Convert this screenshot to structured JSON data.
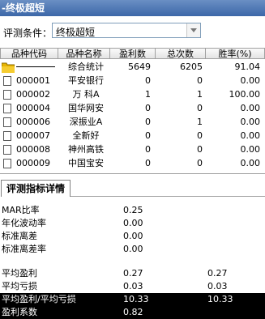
{
  "window": {
    "title": "-终极超短"
  },
  "filter": {
    "label": "评测条件：",
    "selected": "终极超短"
  },
  "table": {
    "headers": [
      "品种代码",
      "品种名称",
      "盈利数",
      "总次数",
      "胜率(%)"
    ],
    "summary": {
      "name": "综合统计",
      "profit": "5649",
      "total": "6205",
      "rate": "91.04"
    },
    "rows": [
      {
        "code": "000001",
        "name": "平安银行",
        "profit": "0",
        "total": "0",
        "rate": "0.00"
      },
      {
        "code": "000002",
        "name": "万 科A",
        "profit": "1",
        "total": "1",
        "rate": "100.00"
      },
      {
        "code": "000004",
        "name": "国华网安",
        "profit": "0",
        "total": "0",
        "rate": "0.00"
      },
      {
        "code": "000006",
        "name": "深振业A",
        "profit": "0",
        "total": "1",
        "rate": "0.00"
      },
      {
        "code": "000007",
        "name": "全新好",
        "profit": "0",
        "total": "0",
        "rate": "0.00"
      },
      {
        "code": "000008",
        "name": "神州高铁",
        "profit": "0",
        "total": "0",
        "rate": "0.00"
      },
      {
        "code": "000009",
        "name": "中国宝安",
        "profit": "0",
        "total": "0",
        "rate": "0.00"
      }
    ]
  },
  "details": {
    "tab_label": "评测指标详情",
    "group1": [
      {
        "label": "MAR比率",
        "value": "0.25"
      },
      {
        "label": "年化波动率",
        "value": "0.00"
      },
      {
        "label": "标准离差",
        "value": "0.00"
      },
      {
        "label": "标准离差率",
        "value": "0.00"
      }
    ],
    "group2": [
      {
        "label": "平均盈利",
        "value": "0.27",
        "value2": "0.27"
      },
      {
        "label": "平均亏损",
        "value": "0.03",
        "value2": "0.03"
      },
      {
        "label": "平均盈利/平均亏损",
        "value": "10.33",
        "value2": "10.33"
      },
      {
        "label": "盈利系数",
        "value": "0.82"
      }
    ]
  },
  "colors": {
    "titlebar": "#3c67a8",
    "highlight": "#000000",
    "folder": "#e8b400"
  }
}
